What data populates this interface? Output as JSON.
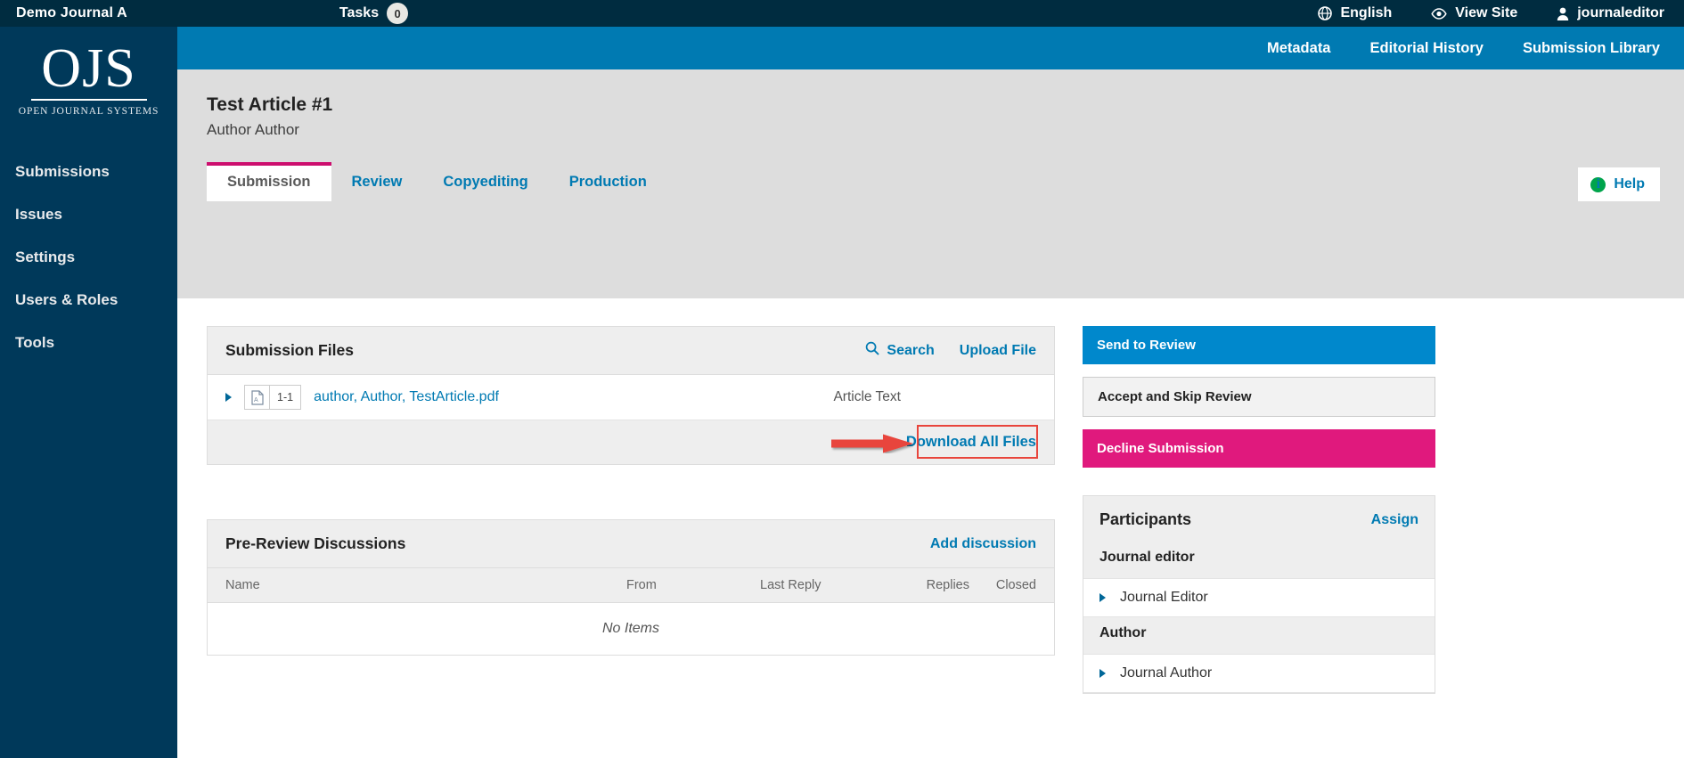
{
  "admin_bar": {
    "journal_name": "Demo Journal A",
    "tasks_label": "Tasks",
    "tasks_count": "0",
    "language": "English",
    "view_site": "View Site",
    "username": "journaleditor",
    "icons": [
      "globe-icon",
      "eye-icon",
      "user-icon"
    ]
  },
  "sidebar": {
    "logo_text": "OJS",
    "logo_subtitle": "OPEN JOURNAL SYSTEMS",
    "items": [
      {
        "label": "Submissions"
      },
      {
        "label": "Issues"
      },
      {
        "label": "Settings"
      },
      {
        "label": "Users & Roles"
      },
      {
        "label": "Tools"
      }
    ]
  },
  "submission_nav": {
    "metadata": "Metadata",
    "editorial_history": "Editorial History",
    "submission_library": "Submission Library"
  },
  "submission": {
    "title": "Test Article #1",
    "author": "Author Author"
  },
  "tabs": [
    {
      "label": "Submission",
      "active": true
    },
    {
      "label": "Review",
      "active": false
    },
    {
      "label": "Copyediting",
      "active": false
    },
    {
      "label": "Production",
      "active": false
    }
  ],
  "help": {
    "label": "Help",
    "icon": "info-icon",
    "glyph": "i"
  },
  "submission_files": {
    "title": "Submission Files",
    "search_label": "Search",
    "search_icon": "search-icon",
    "upload_label": "Upload File",
    "rows": [
      {
        "revision": "1-1",
        "name": "author, Author, TestArticle.pdf",
        "type": "Article Text",
        "icon": "pdf-file-icon"
      }
    ],
    "download_all": "Download All Files"
  },
  "discussions": {
    "title": "Pre-Review Discussions",
    "add_label": "Add discussion",
    "columns": [
      "Name",
      "From",
      "Last Reply",
      "Replies",
      "Closed"
    ],
    "empty_text": "No Items"
  },
  "actions": [
    {
      "label": "Send to Review",
      "style": "primary"
    },
    {
      "label": "Accept and Skip Review",
      "style": "default"
    },
    {
      "label": "Decline Submission",
      "style": "danger"
    }
  ],
  "participants": {
    "title": "Participants",
    "assign_label": "Assign",
    "groups": [
      {
        "role": "Journal editor",
        "members": [
          {
            "name": "Journal Editor"
          }
        ]
      },
      {
        "role": "Author",
        "members": [
          {
            "name": "Journal Author"
          }
        ]
      }
    ]
  },
  "annotation": {
    "type": "arrow-and-box",
    "color": "#e8453c",
    "points_to": "Add discussion"
  },
  "colors": {
    "admin_bar": "#002c40",
    "sidebar": "#00395a",
    "sub_navbar": "#007ab2",
    "link": "#007ab2",
    "active_tab_accent": "#cc0e6e",
    "primary_button": "#0088cc",
    "danger_button": "#e0197d",
    "page_bg": "#dddddd",
    "annotation": "#e8453c"
  }
}
